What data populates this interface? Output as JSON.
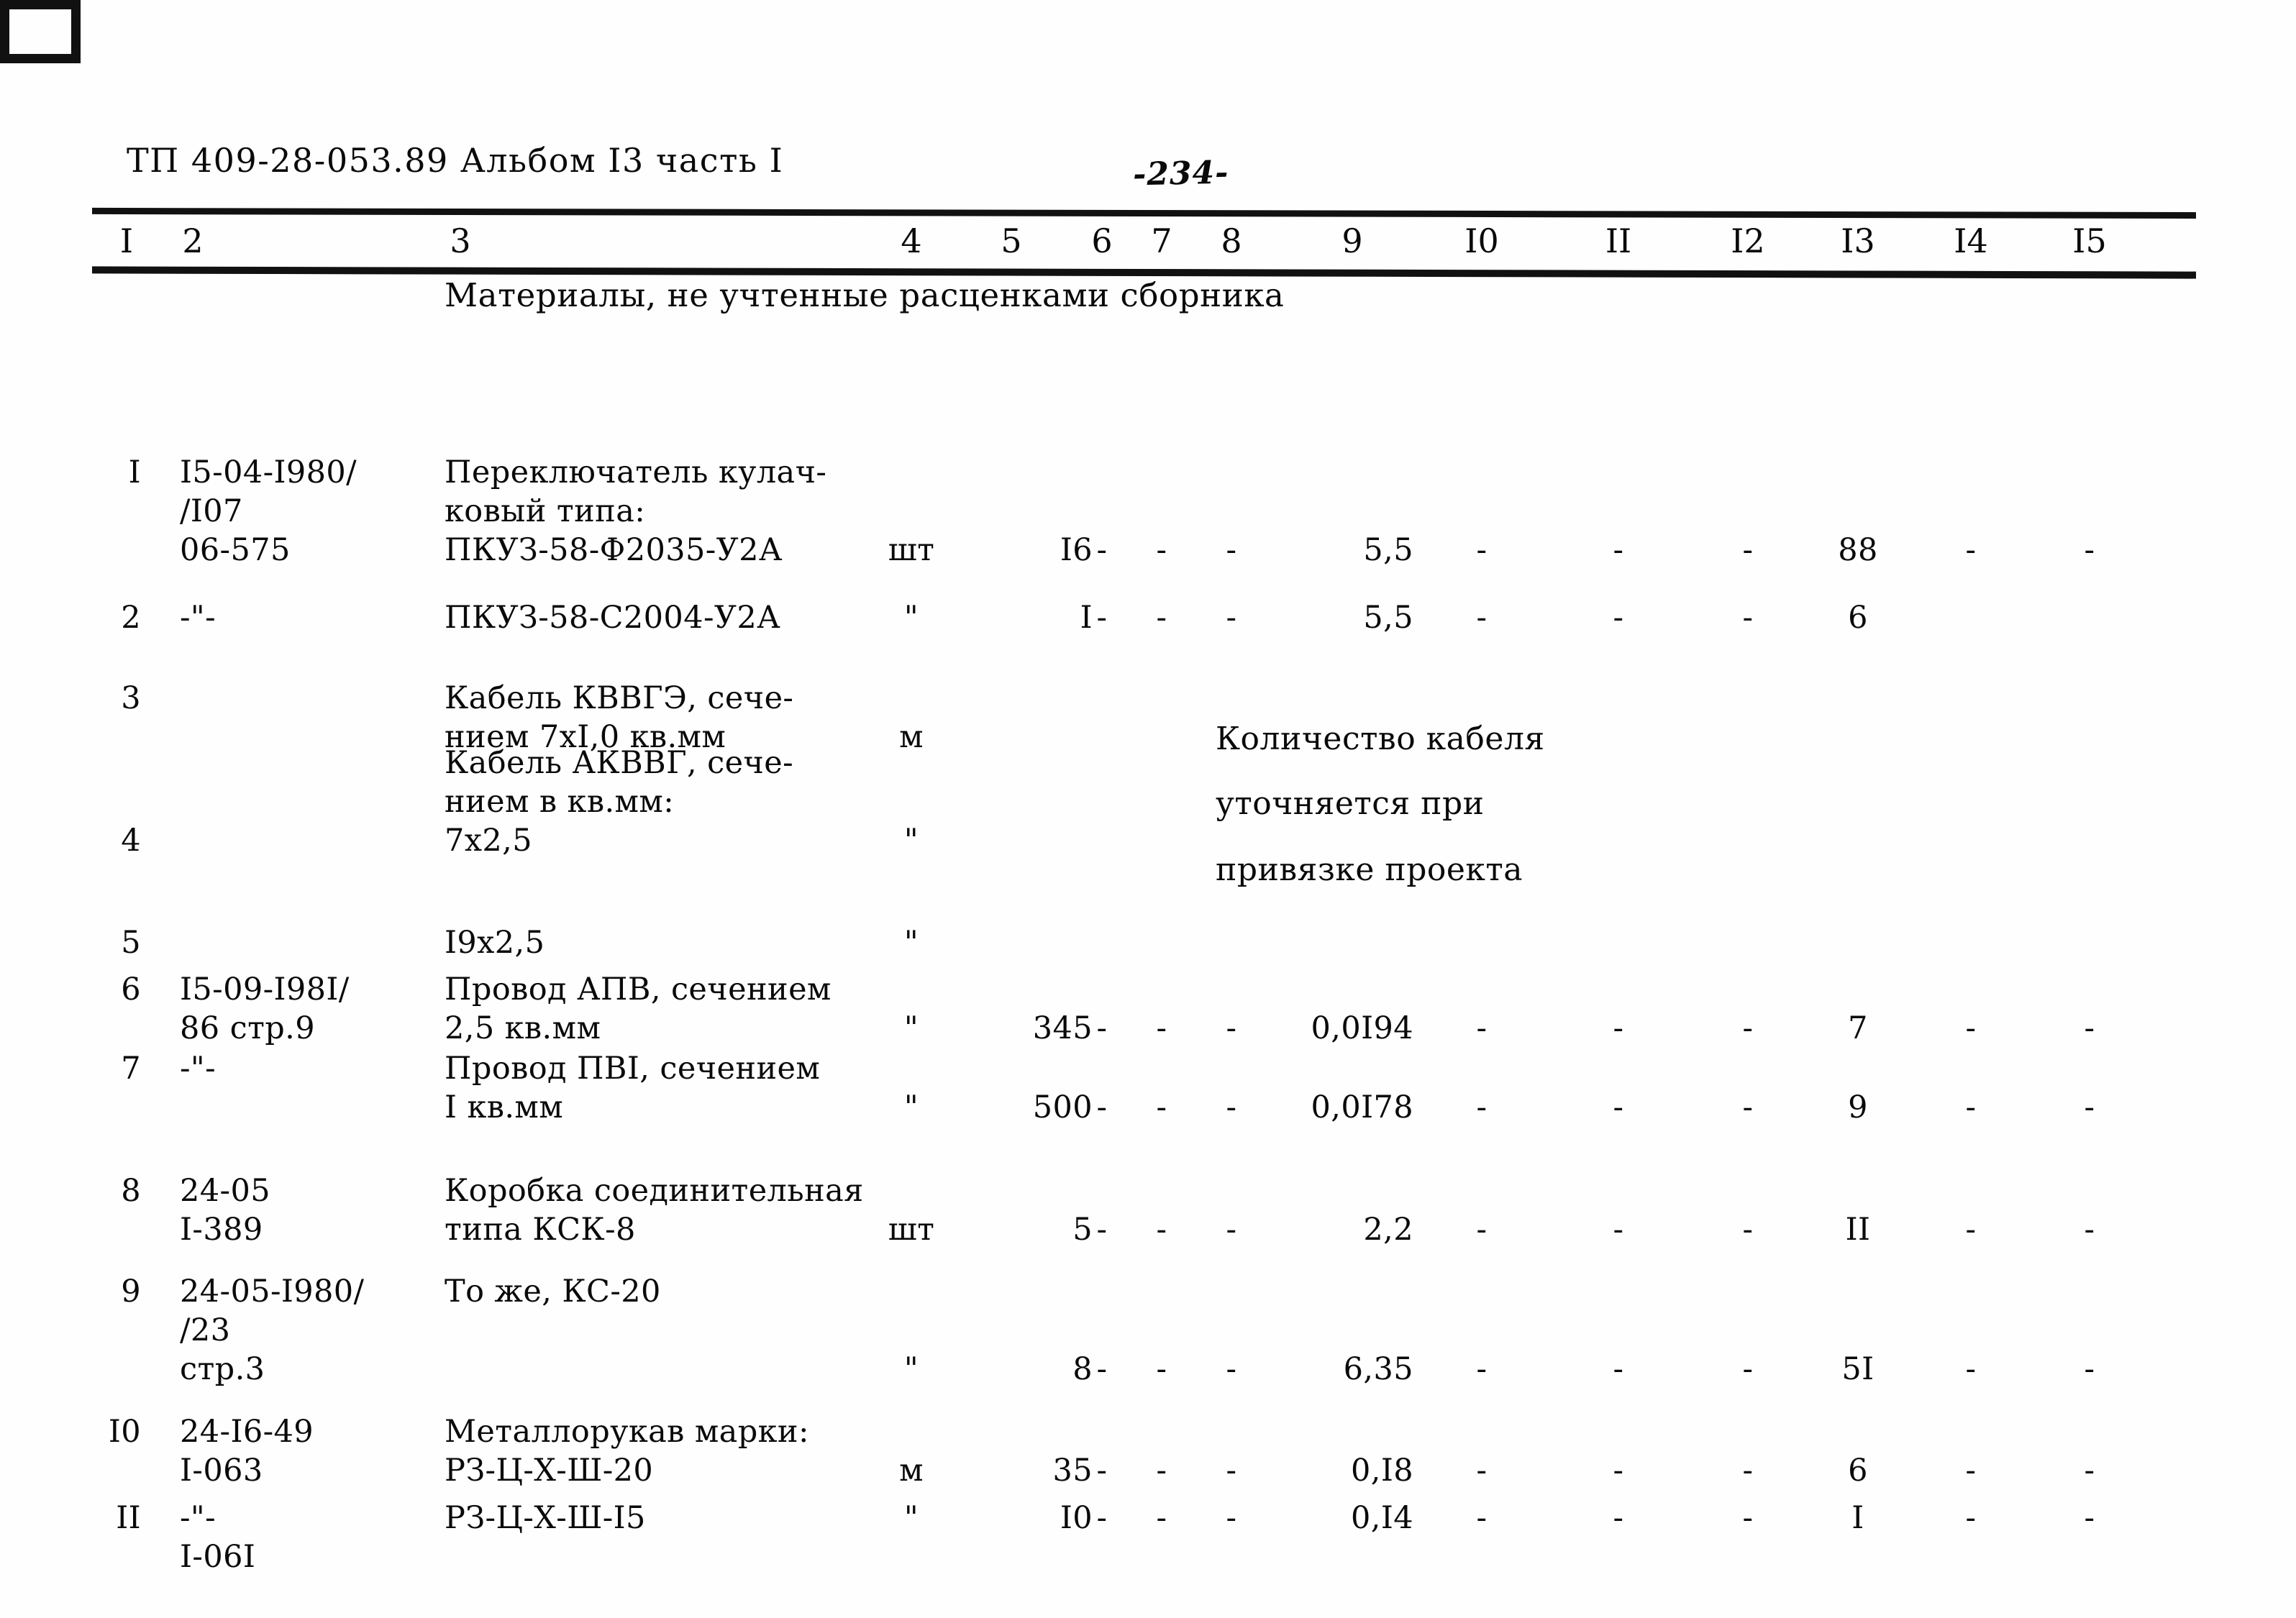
{
  "document": {
    "header": "ТП 409-28-053.89 Альбом I3 часть I",
    "page_label": "-234-"
  },
  "table": {
    "column_headers": [
      "I",
      "2",
      "3",
      "4",
      "5",
      "6",
      "7",
      "8",
      "9",
      "I0",
      "II",
      "I2",
      "I3",
      "I4",
      "I5"
    ],
    "section_title": "Материалы, не учтенные расценками сборника",
    "note_lines": [
      "Количество кабеля",
      "уточняется при",
      "привязке проекта"
    ],
    "rows": [
      {
        "num": "I",
        "code_lines": [
          "I5-04-I980/",
          "/I07",
          "06-575"
        ],
        "name_lines": [
          "Переключатель кулач-",
          "ковый типа:",
          "ПКУЗ-58-Ф2035-У2А"
        ],
        "unit": "шт",
        "c5": "I6",
        "c6": "-",
        "c7": "-",
        "c8": "-",
        "c9": "5,5",
        "c10": "-",
        "c11": "-",
        "c12": "-",
        "c13": "88",
        "c14": "-",
        "c15": "-"
      },
      {
        "num": "2",
        "code_lines": [
          "-\"-"
        ],
        "name_lines": [
          "ПКУЗ-58-С2004-У2А"
        ],
        "unit": "\"",
        "c5": "I",
        "c6": "-",
        "c7": "-",
        "c8": "-",
        "c9": "5,5",
        "c10": "-",
        "c11": "-",
        "c12": "-",
        "c13": "6",
        "c14": "",
        "c15": ""
      },
      {
        "num": "3",
        "code_lines": [],
        "name_lines": [
          "Кабель КВВГЭ, сече-",
          "нием 7хI,0 кв.мм"
        ],
        "unit": "м",
        "c5": "",
        "c6": "",
        "c7": "",
        "c8": "",
        "c9": "",
        "c10": "",
        "c11": "",
        "c12": "",
        "c13": "",
        "c14": "",
        "c15": ""
      },
      {
        "num": "4",
        "code_lines": [],
        "name_lines": [
          "Кабель АКВВГ, сече-",
          "нием в кв.мм:",
          "7х2,5"
        ],
        "unit": "\"",
        "c5": "",
        "c6": "",
        "c7": "",
        "c8": "",
        "c9": "",
        "c10": "",
        "c11": "",
        "c12": "",
        "c13": "",
        "c14": "",
        "c15": ""
      },
      {
        "num": "5",
        "code_lines": [],
        "name_lines": [
          "I9х2,5"
        ],
        "unit": "\"",
        "c5": "",
        "c6": "",
        "c7": "",
        "c8": "",
        "c9": "",
        "c10": "",
        "c11": "",
        "c12": "",
        "c13": "",
        "c14": "",
        "c15": ""
      },
      {
        "num": "6",
        "code_lines": [
          "I5-09-I98I/",
          "86 стр.9"
        ],
        "name_lines": [
          "Провод АПВ, сечением",
          "2,5 кв.мм"
        ],
        "unit": "\"",
        "c5": "345",
        "c6": "-",
        "c7": "-",
        "c8": "-",
        "c9": "0,0I94",
        "c10": "-",
        "c11": "-",
        "c12": "-",
        "c13": "7",
        "c14": "-",
        "c15": "-"
      },
      {
        "num": "7",
        "code_lines": [
          "-\"-"
        ],
        "name_lines": [
          "Провод ПВI, сечением",
          "I кв.мм"
        ],
        "unit": "\"",
        "c5": "500",
        "c6": "-",
        "c7": "-",
        "c8": "-",
        "c9": "0,0I78",
        "c10": "-",
        "c11": "-",
        "c12": "-",
        "c13": "9",
        "c14": "-",
        "c15": "-"
      },
      {
        "num": "8",
        "code_lines": [
          "24-05",
          "I-389"
        ],
        "name_lines": [
          "Коробка соединительная",
          "типа КСК-8"
        ],
        "unit": "шт",
        "c5": "5",
        "c6": "-",
        "c7": "-",
        "c8": "-",
        "c9": "2,2",
        "c10": "-",
        "c11": "-",
        "c12": "-",
        "c13": "II",
        "c14": "-",
        "c15": "-"
      },
      {
        "num": "9",
        "code_lines": [
          "24-05-I980/",
          "/23",
          "стр.3"
        ],
        "name_lines": [
          "То же, КС-20"
        ],
        "unit": "\"",
        "c5": "8",
        "c6": "-",
        "c7": "-",
        "c8": "-",
        "c9": "6,35",
        "c10": "-",
        "c11": "-",
        "c12": "-",
        "c13": "5I",
        "c14": "-",
        "c15": "-"
      },
      {
        "num": "I0",
        "code_lines": [
          "24-I6-49",
          "I-063"
        ],
        "name_lines": [
          "Металлорукав марки:",
          "РЗ-Ц-Х-Ш-20"
        ],
        "unit": "м",
        "c5": "35",
        "c6": "-",
        "c7": "-",
        "c8": "-",
        "c9": "0,I8",
        "c10": "-",
        "c11": "-",
        "c12": "-",
        "c13": "6",
        "c14": "-",
        "c15": "-"
      },
      {
        "num": "II",
        "code_lines": [
          "-\"-",
          "I-06I"
        ],
        "name_lines": [
          "РЗ-Ц-Х-Ш-I5"
        ],
        "unit": "\"",
        "c5": "I0",
        "c6": "-",
        "c7": "-",
        "c8": "-",
        "c9": "0,I4",
        "c10": "-",
        "c11": "-",
        "c12": "-",
        "c13": "I",
        "c14": "-",
        "c15": "-"
      }
    ]
  }
}
